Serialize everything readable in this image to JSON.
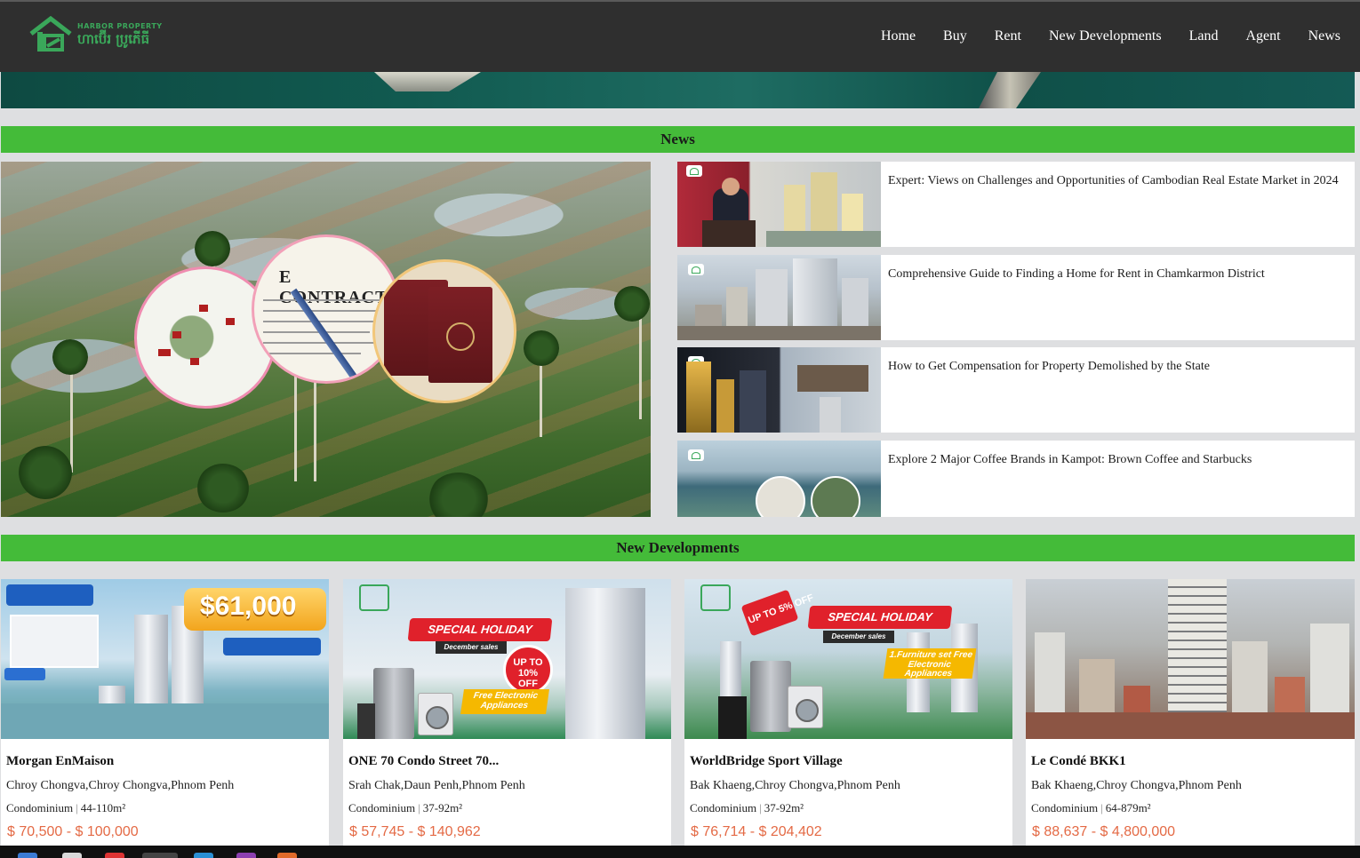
{
  "brand": {
    "name_en": "HARBOR PROPERTY",
    "name_km": "ហាប៊ើរ ប្រូភើធី",
    "accent": "#44bb39",
    "logo_color": "#3aa75a"
  },
  "nav": {
    "items": [
      "Home",
      "Buy",
      "Rent",
      "New Developments",
      "Land",
      "Agent",
      "News"
    ]
  },
  "news_section": {
    "title": "News",
    "featured_overlay_text": "E CONTRACT",
    "items": [
      {
        "title": "Expert: Views on Challenges and Opportunities of Cambodian Real Estate Market in 2024"
      },
      {
        "title": "Comprehensive Guide to Finding a Home for Rent in Chamkarmon District"
      },
      {
        "title": "How to Get Compensation for Property Demolished by the State"
      },
      {
        "title": "Explore 2 Major Coffee Brands in Kampot: Brown Coffee and Starbucks"
      }
    ]
  },
  "developments_section": {
    "title": "New Developments",
    "cards": [
      {
        "name": "Morgan EnMaison",
        "location": "Chroy Chongva,Chroy Chongva,Phnom Penh",
        "type": "Condominium",
        "size": "44-110m²",
        "price_min": "$ 70,500 -",
        "price_max": "$ 100,000",
        "promo_price": "$61,000"
      },
      {
        "name": "ONE 70 Condo Street 70...",
        "location": "Srah Chak,Daun Penh,Phnom Penh",
        "type": "Condominium",
        "size": "37-92m²",
        "price_min": "$ 57,745 -",
        "price_max": "$ 140,962",
        "promo_title": "SPECIAL HOLIDAY",
        "promo_sub": "December sales",
        "promo_badge": "UP TO 10% OFF",
        "promo_note": "Free Electronic Appliances"
      },
      {
        "name": "WorldBridge Sport Village",
        "location": "Bak Khaeng,Chroy Chongva,Phnom Penh",
        "type": "Condominium",
        "size": "37-92m²",
        "price_min": "$ 76,714 -",
        "price_max": "$ 204,402",
        "promo_title": "SPECIAL HOLIDAY",
        "promo_sub": "December sales",
        "promo_badge": "UP TO 5% OFF",
        "promo_note": "1.Furniture set Free Electronic Appliances"
      },
      {
        "name": "Le Condé BKK1",
        "location": "Bak Khaeng,Chroy Chongva,Phnom Penh",
        "type": "Condominium",
        "size": "64-879m²",
        "price_min": "$ 88,637 -",
        "price_max": "$ 4,800,000"
      }
    ]
  }
}
